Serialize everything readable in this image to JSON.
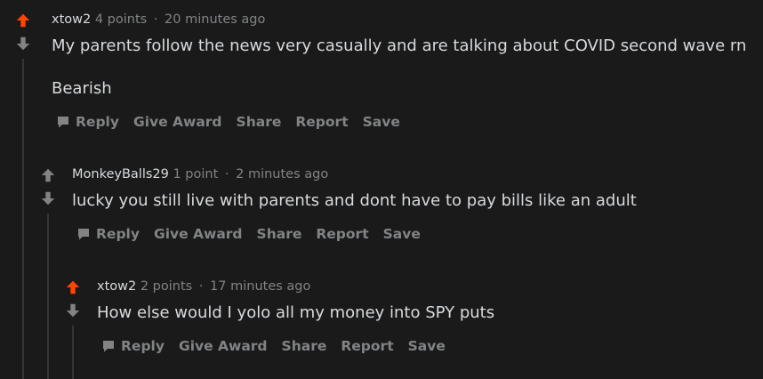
{
  "colors": {
    "background": "#1a1a1b",
    "upvote_active": "#ff4500",
    "vote_inactive": "#818384",
    "text_primary": "#d7dadc",
    "text_meta": "#818384",
    "thread_line": "#343536"
  },
  "comments": [
    {
      "author": "xtow2",
      "points": "4 points",
      "separator": "·",
      "time": "20 minutes ago",
      "body": [
        "My parents follow the news very casually and are talking about COVID second wave rn",
        "Bearish"
      ],
      "upvoted": true,
      "actions": {
        "reply": "Reply",
        "give_award": "Give Award",
        "share": "Share",
        "report": "Report",
        "save": "Save"
      }
    },
    {
      "author": "MonkeyBalls29",
      "points": "1 point",
      "separator": "·",
      "time": "2 minutes ago",
      "body": [
        "lucky you still live with parents and dont have to pay bills like an adult"
      ],
      "upvoted": false,
      "actions": {
        "reply": "Reply",
        "give_award": "Give Award",
        "share": "Share",
        "report": "Report",
        "save": "Save"
      }
    },
    {
      "author": "xtow2",
      "points": "2 points",
      "separator": "·",
      "time": "17 minutes ago",
      "body": [
        "How else would I yolo all my money into SPY puts"
      ],
      "upvoted": true,
      "actions": {
        "reply": "Reply",
        "give_award": "Give Award",
        "share": "Share",
        "report": "Report",
        "save": "Save"
      }
    }
  ]
}
